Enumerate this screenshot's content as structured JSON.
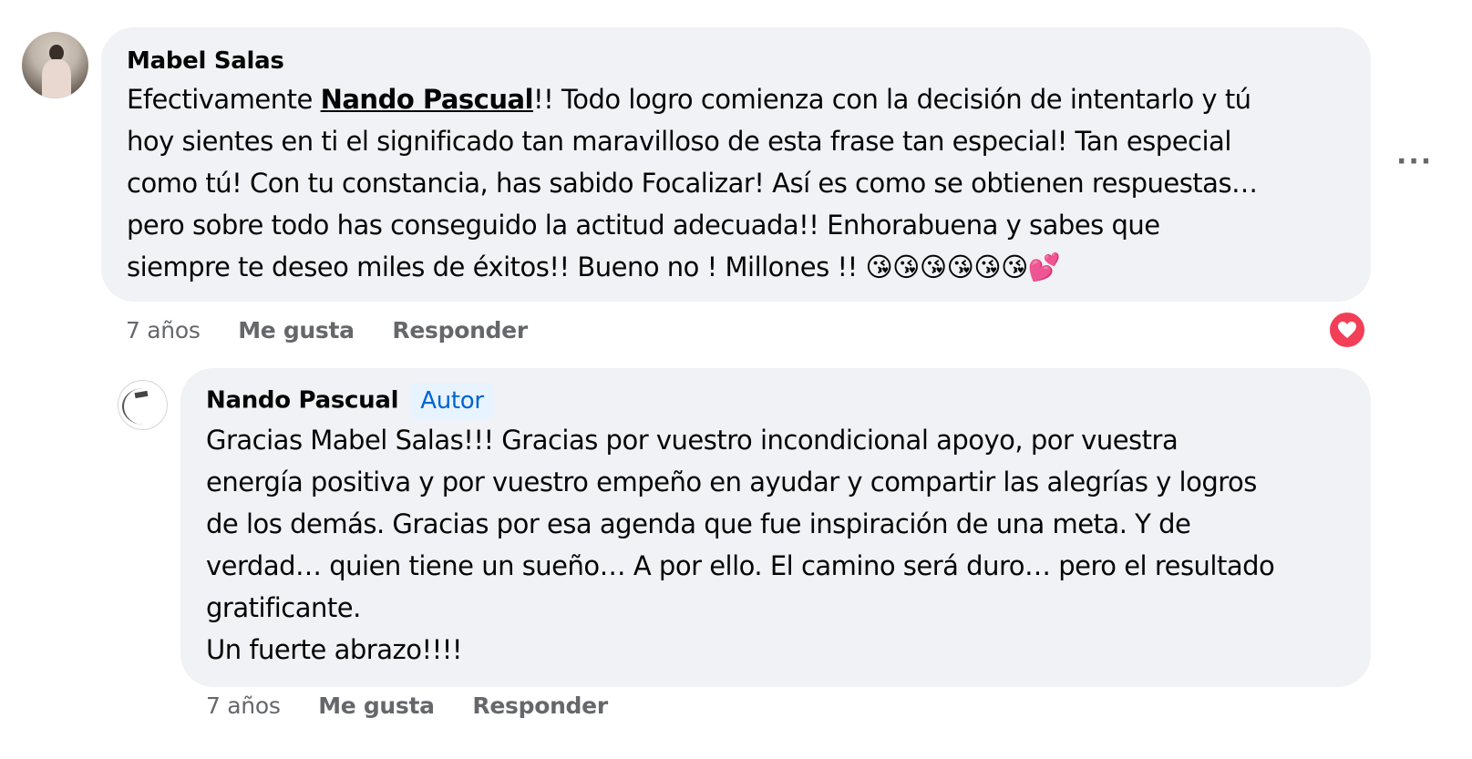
{
  "comment": {
    "author": "Mabel Salas",
    "text_before": "Efectivamente ",
    "mention": "Nando Pascual",
    "text_after": "!! Todo logro comienza con la decisión de intentarlo y tú\nhoy sientes en ti el significado tan maravilloso de esta frase tan especial! Tan especial\ncomo tú! Con tu constancia, has sabido Focalizar! Así es como se obtienen respuestas…\npero sobre todo has conseguido la actitud adecuada!! Enhorabuena y sabes que\nsiempre te deseo miles de éxitos!! Bueno no ! Millones !! ",
    "emojis": "😘😘😘😘😘😘💕",
    "time": "7 años",
    "like_label": "Me gusta",
    "reply_label": "Responder",
    "reaction_icon": "heart-icon",
    "more_label": "···"
  },
  "reply": {
    "author": "Nando Pascual",
    "badge": "Autor",
    "text": "Gracias Mabel Salas!!! Gracias por vuestro incondicional apoyo, por vuestra\nenergía positiva y por vuestro empeño en ayudar y compartir las alegrías y logros\nde los demás. Gracias por esa agenda que fue inspiración de una meta. Y de\nverdad… quien tiene un sueño… A por ello. El camino será duro… pero el resultado\ngratificante.\nUn fuerte abrazo!!!!",
    "time": "7 años",
    "like_label": "Me gusta",
    "reply_label": "Responder"
  },
  "colors": {
    "bubble": "#f0f2f5",
    "meta_text": "#65676b",
    "badge_bg": "#e7f3ff",
    "badge_text": "#0064d1",
    "reaction": "#f33e58"
  }
}
